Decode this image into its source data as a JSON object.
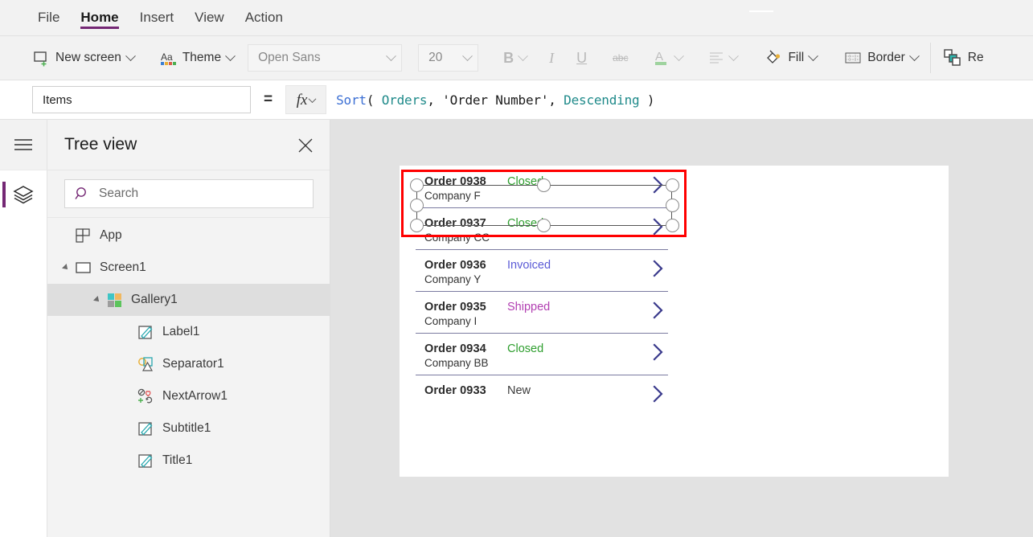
{
  "ribbon": {
    "tabs": [
      {
        "label": "File",
        "active": false
      },
      {
        "label": "Home",
        "active": true
      },
      {
        "label": "Insert",
        "active": false
      },
      {
        "label": "View",
        "active": false
      },
      {
        "label": "Action",
        "active": false
      }
    ],
    "accent_color": "#742774",
    "toolbar": {
      "new_screen_label": "New screen",
      "theme_label": "Theme",
      "font_family_value": "Open Sans",
      "font_size_value": "20",
      "bold_label": "B",
      "italic_label": "I",
      "underline_label": "U",
      "strikethrough_label": "abc",
      "font_color_label": "A",
      "font_color_swatch": "#9fd39f",
      "align_label": "",
      "fill_label": "Fill",
      "border_label": "Border",
      "reorder_label": "Re"
    }
  },
  "formula_bar": {
    "property_value": "Items",
    "equals": "=",
    "fx_label": "fx",
    "formula_tokens": [
      {
        "text": "Sort",
        "color": "#3b6fd4"
      },
      {
        "text": "( ",
        "color": "#1b1b1b"
      },
      {
        "text": "Orders",
        "color": "#1f8a8a"
      },
      {
        "text": ", ",
        "color": "#1b1b1b"
      },
      {
        "text": "'Order Number'",
        "color": "#1b1b1b"
      },
      {
        "text": ", ",
        "color": "#1b1b1b"
      },
      {
        "text": "Descending",
        "color": "#1f8a8a"
      },
      {
        "text": " )",
        "color": "#1b1b1b"
      }
    ]
  },
  "left_rail": {
    "hamburger_name": "hamburger-icon",
    "layers_name": "layers-icon",
    "selected": "layers"
  },
  "tree_view": {
    "title": "Tree view",
    "close_label": "",
    "search_placeholder": "Search",
    "search_value": "",
    "items": [
      {
        "label": "App",
        "indent": 0,
        "caret": "none",
        "icon": "app-icon",
        "selected": false
      },
      {
        "label": "Screen1",
        "indent": 0,
        "caret": "expanded",
        "icon": "screen-icon",
        "selected": false
      },
      {
        "label": "Gallery1",
        "indent": 1,
        "caret": "expanded",
        "icon": "gallery-icon",
        "selected": true
      },
      {
        "label": "Label1",
        "indent": 2,
        "caret": "none",
        "icon": "label-icon",
        "selected": false
      },
      {
        "label": "Separator1",
        "indent": 2,
        "caret": "none",
        "icon": "separator-icon",
        "selected": false
      },
      {
        "label": "NextArrow1",
        "indent": 2,
        "caret": "none",
        "icon": "nextarrow-icon",
        "selected": false
      },
      {
        "label": "Subtitle1",
        "indent": 2,
        "caret": "none",
        "icon": "label-icon",
        "selected": false
      },
      {
        "label": "Title1",
        "indent": 2,
        "caret": "none",
        "icon": "label-icon",
        "selected": false
      }
    ]
  },
  "canvas": {
    "background_color": "#e2e2e2",
    "screen_color": "#ffffff",
    "selection_border_color": "#ff0000",
    "gallery": {
      "status_colors": {
        "Closed": "#2e9e2e",
        "Invoiced": "#5b5bd6",
        "Shipped": "#b23fb2",
        "New": "#3b3b3b"
      },
      "items": [
        {
          "title": "Order 0938",
          "subtitle": "Company F",
          "status": "Closed",
          "selected": true
        },
        {
          "title": "Order 0937",
          "subtitle": "Company CC",
          "status": "Closed",
          "selected": false
        },
        {
          "title": "Order 0936",
          "subtitle": "Company Y",
          "status": "Invoiced",
          "selected": false
        },
        {
          "title": "Order 0935",
          "subtitle": "Company I",
          "status": "Shipped",
          "selected": false
        },
        {
          "title": "Order 0934",
          "subtitle": "Company BB",
          "status": "Closed",
          "selected": false
        },
        {
          "title": "Order 0933",
          "subtitle": "",
          "status": "New",
          "selected": false
        }
      ]
    }
  }
}
